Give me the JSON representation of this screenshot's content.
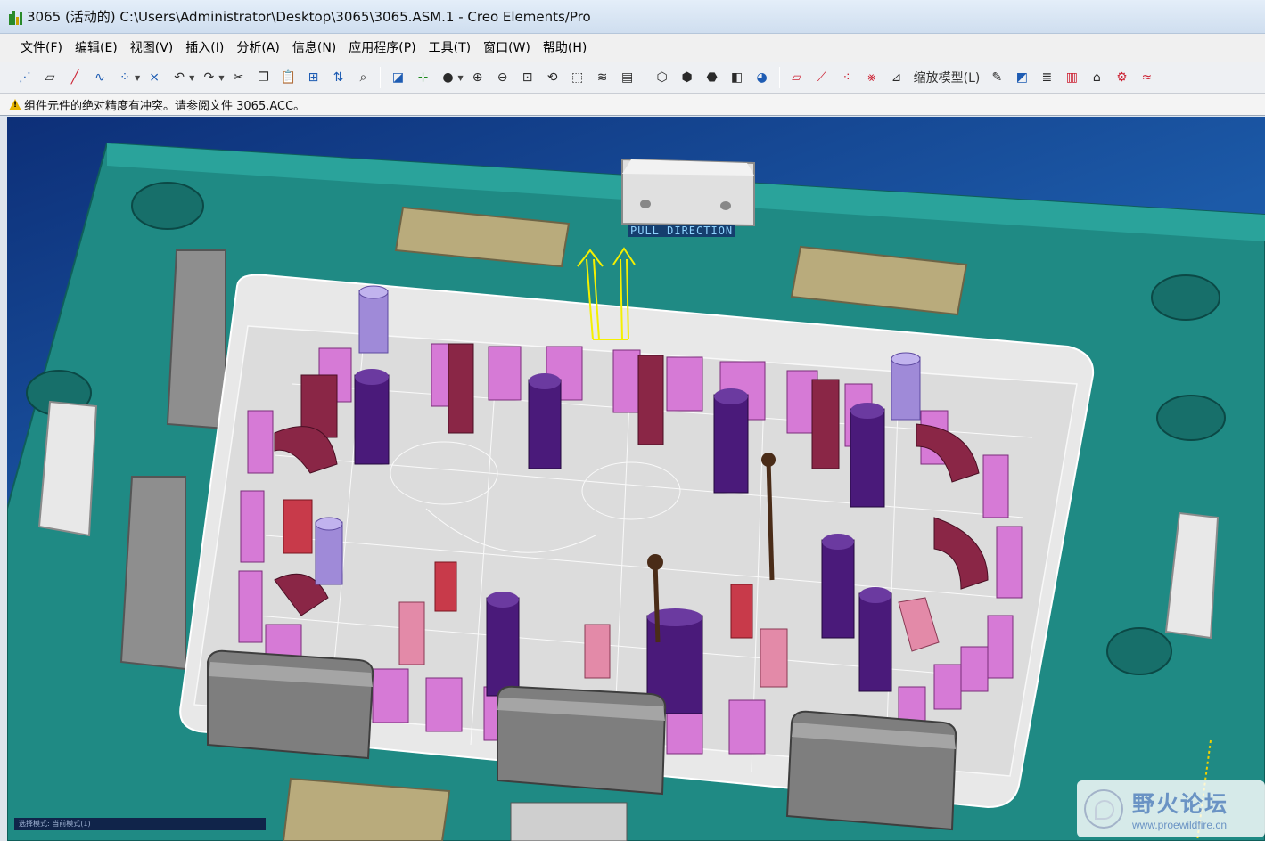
{
  "window": {
    "title": "3065 (活动的) C:\\Users\\Administrator\\Desktop\\3065\\3065.ASM.1 - Creo Elements/Pro"
  },
  "menu": [
    "文件(F)",
    "编辑(E)",
    "视图(V)",
    "插入(I)",
    "分析(A)",
    "信息(N)",
    "应用程序(P)",
    "工具(T)",
    "窗口(W)",
    "帮助(H)"
  ],
  "toolbar": {
    "zoom_model_label": "缩放模型(L)",
    "icons": [
      "datum-display-icon",
      "plane-icon",
      "axis-icon",
      "curve-icon",
      "point-icon",
      "csys-icon",
      "undo-icon",
      "redo-icon",
      "cut-icon",
      "copy-icon",
      "paste-icon",
      "paste-special-icon",
      "regenerate-icon",
      "find-icon",
      "repaint-icon",
      "spin-center-icon",
      "shading-icon",
      "zoom-in-icon",
      "zoom-out-icon",
      "refit-icon",
      "reorient-icon",
      "saved-views-icon",
      "layers-icon",
      "model-tree-icon",
      "wireframe-icon",
      "hidden-line-icon",
      "no-hidden-icon",
      "shaded-icon",
      "enhanced-realism-icon",
      "datum-plane-display-icon",
      "datum-axis-display-icon",
      "point-display-icon",
      "csys-display-icon",
      "annotation-display-icon",
      "draw-icon",
      "sketch-icon",
      "layer-icon",
      "color-icon",
      "mold-icon",
      "analysis-icon",
      "curvature-icon"
    ]
  },
  "message": {
    "text": "组件元件的绝对精度有冲突。请参阅文件 3065.ACC。"
  },
  "viewport": {
    "pull_direction_label": "PULL DIRECTION",
    "status_strip_text": "选择模式: 当前模式(1)",
    "background_colors": [
      "#0d2f78",
      "#2d72be"
    ],
    "mold_base_color": "#1f8a84",
    "insert_color": "#e5e5e5",
    "slider_color": "#e07be0",
    "ejector_pin_color": "#4a1a7a"
  },
  "watermark": {
    "title": "野火论坛",
    "url": "www.proewildfire.cn"
  }
}
